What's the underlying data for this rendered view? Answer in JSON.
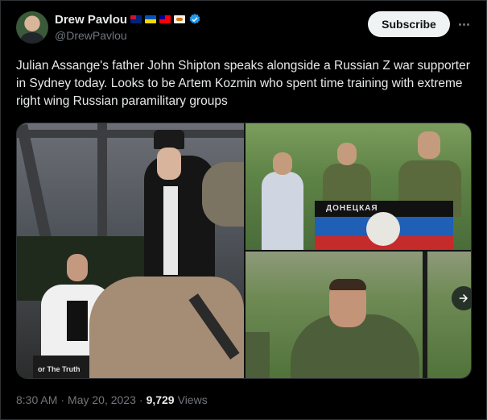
{
  "author": {
    "display_name": "Drew Pavlou",
    "handle": "@DrewPavlou",
    "flag_icons": [
      "australia-flag-icon",
      "ukraine-flag-icon",
      "taiwan-flag-icon",
      "cyprus-flag-icon"
    ],
    "verified": true
  },
  "actions": {
    "subscribe_label": "Subscribe",
    "more_icon": "more-horizontal-icon"
  },
  "tweet": {
    "text": "Julian Assange's father John Shipton speaks alongside a Russian Z war supporter in Sydney today. Looks to be Artem Kozmin who spent time training with extreme right wing Russian paramilitary groups"
  },
  "media": {
    "photo1_sign_text": "or The Truth",
    "photo2_banner_text": "ДОНЕЦКАЯ",
    "next_icon": "arrow-right-icon"
  },
  "meta": {
    "time": "8:30 AM",
    "separator": "·",
    "date": "May 20, 2023",
    "views_count": "9,729",
    "views_label": "Views"
  },
  "colors": {
    "background": "#000000",
    "text_primary": "#e7e9ea",
    "text_secondary": "#71767b",
    "verified_blue": "#1d9bf0",
    "subscribe_bg": "#eff3f4"
  }
}
